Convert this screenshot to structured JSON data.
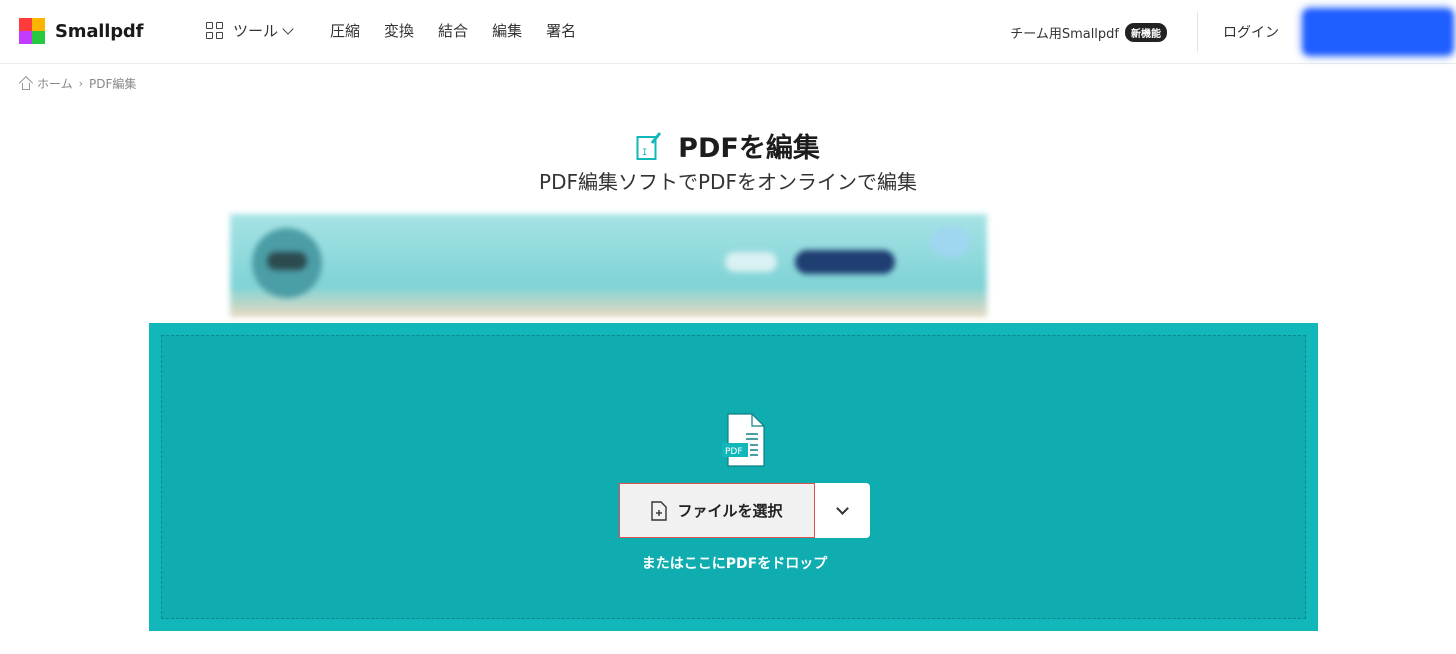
{
  "header": {
    "logo_text": "Smallpdf",
    "logo_colors": [
      "#ff3b3b",
      "#ffb400",
      "#2f7dff",
      "#27c93f"
    ],
    "tools_label": "ツール",
    "nav_items": [
      "圧縮",
      "変換",
      "結合",
      "編集",
      "署名"
    ],
    "team_link": "チーム用Smallpdf",
    "new_badge": "新機能",
    "login": "ログイン",
    "cta_color": "#1f5eff"
  },
  "breadcrumb": {
    "home": "ホーム",
    "current": "PDF編集"
  },
  "hero": {
    "title": "PDFを編集",
    "subtitle": "PDF編集ソフトでPDFをオンラインで編集",
    "accent_color": "#12b7b9"
  },
  "dropzone": {
    "file_icon_label": "PDF",
    "select_button": "ファイルを選択",
    "drop_hint": "またはここにPDFをドロップ",
    "background": "#12b7b9"
  }
}
